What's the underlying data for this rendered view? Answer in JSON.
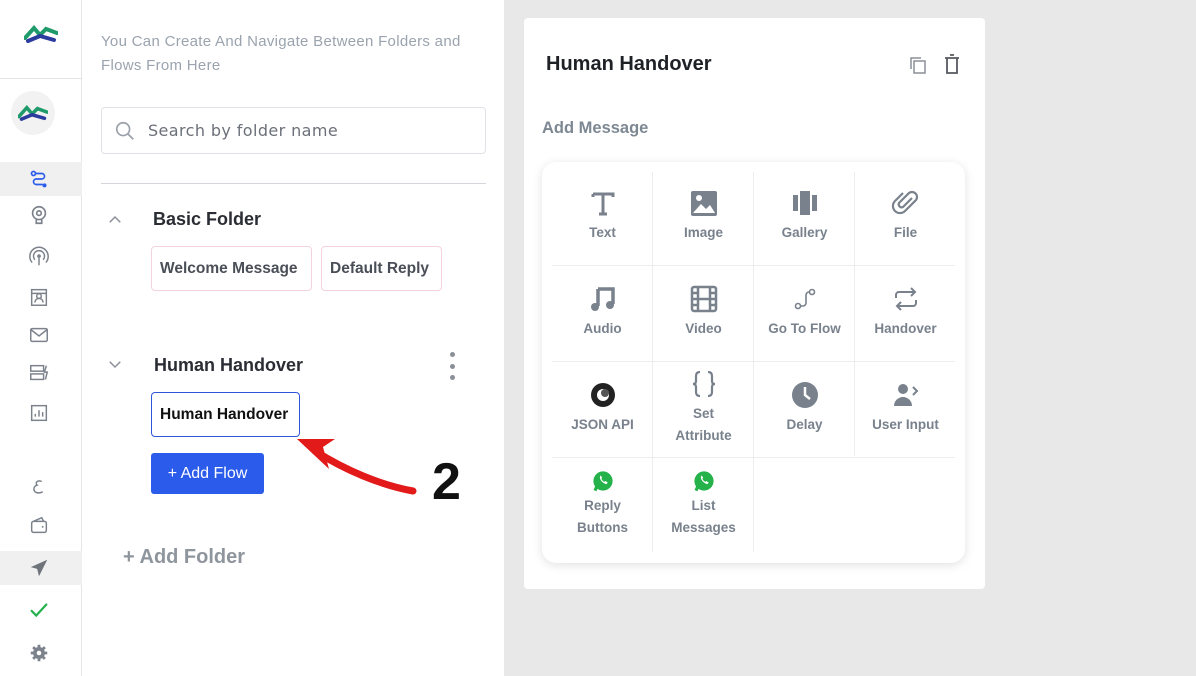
{
  "folders_panel": {
    "hint": "You Can Create And Navigate Between Folders and Flows From Here",
    "search_placeholder": "Search by folder name",
    "folders": [
      {
        "name": "Basic Folder",
        "flows": [
          "Welcome Message",
          "Default Reply"
        ]
      },
      {
        "name": "Human Handover",
        "flows": [
          "Human Handover"
        ]
      }
    ],
    "add_flow_label": "+ Add Flow",
    "add_folder_label": "+ Add Folder"
  },
  "annotation": {
    "step_number": "2",
    "color": "#e21a1a"
  },
  "editor": {
    "title": "Human Handover",
    "add_message_label": "Add Message",
    "message_types": [
      "Text",
      "Image",
      "Gallery",
      "File",
      "Audio",
      "Video",
      "Go To Flow",
      "Handover",
      "JSON API",
      "Set Attribute",
      "Delay",
      "User Input",
      "Reply Buttons",
      "List Messages"
    ]
  },
  "colors": {
    "primary": "#2b5bea",
    "active_chip_border": "#2f56d9",
    "whatsapp": "#25b24a",
    "icon_gray": "#78818c"
  }
}
